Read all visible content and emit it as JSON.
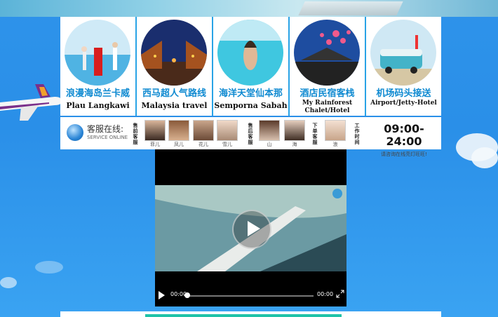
{
  "destinations": [
    {
      "cn": "浪漫海岛兰卡威",
      "en": "Plau Langkawi",
      "small": false
    },
    {
      "cn": "西马超人气路线",
      "en": "Malaysia travel",
      "small": false
    },
    {
      "cn": "海洋天堂仙本那",
      "en": "Semporna Sabah",
      "small": false
    },
    {
      "cn": "酒店民宿客栈",
      "en": "My Rainforest Chalet/Hotel",
      "small": true
    },
    {
      "cn": "机场码头接送",
      "en": "Airport/Jetty-Hotel",
      "small": true
    }
  ],
  "service": {
    "title": "客服在线:",
    "subtitle": "SERVICE ONLINE",
    "pre_sales_label": "售前客服",
    "after_sales_label": "售后客服",
    "orders_label": "下单客服",
    "work_time_label": "工作时间",
    "pre_sales": [
      "菲儿",
      "凤儿",
      "花儿",
      "雪儿"
    ],
    "after_sales": [
      "山",
      "海"
    ],
    "orders": [
      "浪"
    ],
    "hours": "09:00-24:00",
    "hours_note": "请咨询在线亮灯旺旺!"
  },
  "video": {
    "current_time": "00:00",
    "duration": "00:00"
  },
  "colors": {
    "sky": "#2e93ea",
    "accent_blue": "#0f8ad1",
    "teal": "#20c3a8"
  }
}
